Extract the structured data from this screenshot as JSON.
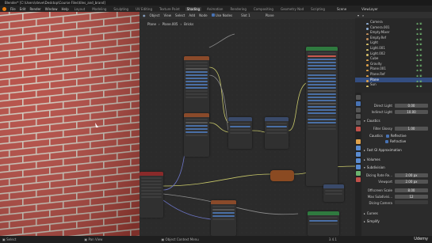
{
  "app": {
    "title": "Blender* [C:\\Users\\steve\\Desktop\\Course Files\\tiles_and_brand]"
  },
  "menu": {
    "items": [
      "File",
      "Edit",
      "Render",
      "Window",
      "Help"
    ],
    "workspaces": [
      "Layout",
      "Modeling",
      "Sculpting",
      "UV Editing",
      "Texture Paint",
      "Shading",
      "Animation",
      "Rendering",
      "Compositing",
      "Geometry Nod",
      "Scripting"
    ],
    "active_workspace": "Shading",
    "scene_label": "Scene",
    "view_layer_label": "ViewLayer"
  },
  "node_editor": {
    "header": [
      "Object",
      "View",
      "Select",
      "Add",
      "Node",
      "Use Nodes",
      "Slot 1",
      "Plane"
    ],
    "breadcrumb": [
      "Plane",
      "Plane.005",
      "Bricks"
    ]
  },
  "outliner": {
    "items": [
      {
        "label": "Camera",
        "color": "#8fb0d8"
      },
      {
        "label": "Camera.001",
        "color": "#8fb0d8"
      },
      {
        "label": "Empty.Mixer",
        "color": "#c48f5a"
      },
      {
        "label": "Empty.Ref",
        "color": "#c48f5a"
      },
      {
        "label": "Light",
        "color": "#d8c26a"
      },
      {
        "label": "Light.001",
        "color": "#d8c26a"
      },
      {
        "label": "Light.002",
        "color": "#d8c26a"
      },
      {
        "label": "Cube",
        "color": "#e0a24a"
      },
      {
        "label": "Gravity",
        "color": "#e0a24a"
      },
      {
        "label": "Plane.001",
        "color": "#e0a24a"
      },
      {
        "label": "Plane.Ref",
        "color": "#e0a24a"
      },
      {
        "label": "Plane",
        "color": "#e0a24a",
        "selected": true
      },
      {
        "label": "Sun",
        "color": "#d8c26a"
      }
    ]
  },
  "properties": {
    "rows": [
      {
        "label": "Direct Light",
        "value": "0.00"
      },
      {
        "label": "Indirect Light",
        "value": "10.00"
      }
    ],
    "caustics_header": "Caustics",
    "filter_glossy": {
      "label": "Filter Glossy",
      "value": "1.00"
    },
    "caustics_label": "Caustics",
    "reflective": "Reflective",
    "refractive": "Refractive",
    "fast_gi": "Fast GI Approximation",
    "volumes": "Volumes",
    "subdivision": "Subdivision",
    "dicing": [
      {
        "label": "Dicing Rate Re...",
        "value": "2.00 px"
      },
      {
        "label": "Viewport",
        "value": "2.00 px"
      },
      {
        "label": "Offscreen Scale",
        "value": "8.00"
      },
      {
        "label": "Max Subdivisi...",
        "value": "12"
      }
    ],
    "dicing_camera": "Dicing Camera",
    "curves": "Curves",
    "simplify": "Simplify"
  },
  "statusbar": {
    "items": [
      "Select",
      "Pan View",
      "Object Context Menu"
    ],
    "version": "3.4.1"
  },
  "watermark": "Udemy"
}
